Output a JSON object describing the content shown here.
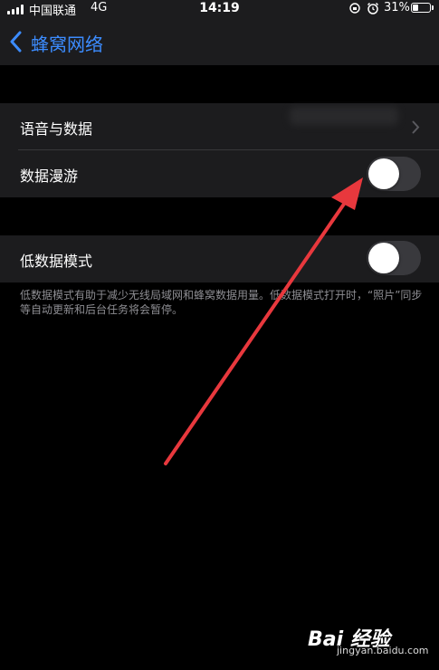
{
  "status_bar": {
    "carrier": "中国联通",
    "network": "4G",
    "time": "14:19",
    "battery_percent": "31%",
    "battery_level": 0.31,
    "icons": [
      "signal-icon",
      "rotation-lock-icon",
      "alarm-icon",
      "battery-icon"
    ]
  },
  "nav": {
    "back_label": "蜂窝网络",
    "accent_color": "#3c8cff"
  },
  "rows": {
    "voice_data": {
      "label": "语音与数据"
    },
    "data_roaming": {
      "label": "数据漫游",
      "on": false
    },
    "low_data_mode": {
      "label": "低数据模式",
      "on": false
    }
  },
  "footer_note": "低数据模式有助于减少无线局域网和蜂窝数据用量。低数据模式打开时，“照片”同步等自动更新和后台任务将会暂停。",
  "annotation": {
    "arrow_color": "#e8383d"
  },
  "watermark": {
    "logo": "Bai 经验",
    "url": "jingyan.baidu.com"
  }
}
